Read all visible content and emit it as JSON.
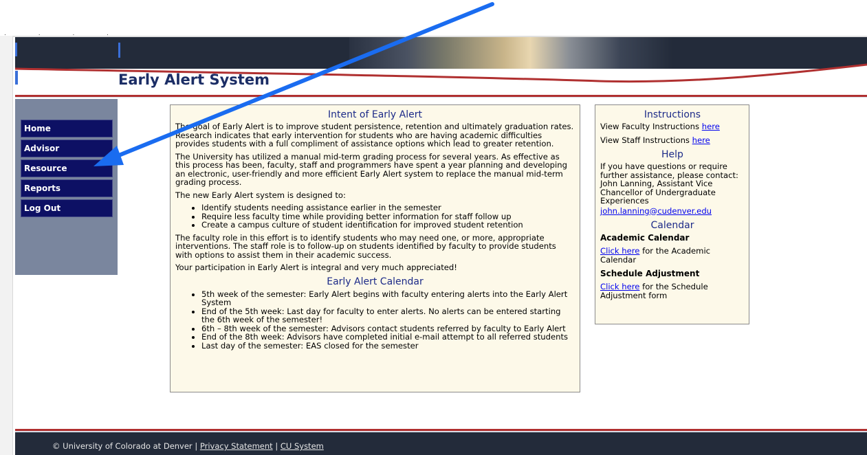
{
  "header": {
    "title": "Early Alert System"
  },
  "nav": {
    "items": [
      {
        "label": "Home"
      },
      {
        "label": "Advisor"
      },
      {
        "label": "Resource"
      },
      {
        "label": "Reports"
      },
      {
        "label": "Log Out"
      }
    ]
  },
  "main": {
    "heading": "Intent of Early Alert",
    "p1": "The goal of Early Alert is to improve student persistence, retention and ultimately graduation rates. Research indicates that early intervention for students who are having academic difficulties provides students with a full compliment of assistance options which lead to greater retention.",
    "p2": "The University has utilized a manual mid-term grading process for several years. As effective as this process has been, faculty, staff and programmers have spent a year planning and developing an electronic, user-friendly and more efficient Early Alert system to replace the manual mid-term grading process.",
    "p3": "The new Early Alert system is designed to:",
    "goals": [
      "Identify students needing assistance earlier in the semester",
      "Require less faculty time while providing better information for staff follow up",
      "Create a campus culture of student identification for improved student retention"
    ],
    "p4": "The faculty role in this effort is to identify students who may need one, or more, appropriate interventions. The staff role is to follow-up on students identified by faculty to provide students with options to assist them in their academic success.",
    "p5": "Your participation in Early Alert is integral and very much appreciated!",
    "calendar_heading": "Early Alert Calendar",
    "calendar": [
      "5th week of the semester: Early Alert begins with faculty entering alerts into the Early Alert System",
      "End of the 5th week: Last day for faculty to enter alerts. No alerts can be entered starting the 6th week of the semester!",
      "6th – 8th week of the semester: Advisors contact students referred by faculty to Early Alert",
      "End of the 8th week: Advisors have completed initial e-mail attempt to all referred students",
      "Last day of the semester: EAS closed for the semester"
    ]
  },
  "side": {
    "instructions_heading": "Instructions",
    "faculty_text": "View Faculty Instructions",
    "staff_text": "View Staff Instructions",
    "here_link": "here",
    "help_heading": "Help",
    "help_text": "If you have questions or require further assistance, please contact: John Lanning, Assistant Vice Chancellor of Undergraduate Experiences",
    "help_email": "john.lanning@cudenver.edu",
    "calendar_heading": "Calendar",
    "academic_label": "Academic Calendar",
    "academic_link": "Click here",
    "academic_text": "for the Academic Calendar",
    "schedule_label": "Schedule Adjustment",
    "schedule_link": "Click here",
    "schedule_text": "for the Schedule Adjustment form"
  },
  "footer": {
    "copyright": "© University of Colorado at Denver |",
    "privacy": "Privacy Statement",
    "separator": "|",
    "cu_system": "CU System"
  },
  "colors": {
    "header_dark": "#232b3a",
    "nav_blue": "#0d1064",
    "sidebar_gray": "#7a869e",
    "panel_bg": "#fdf9e9",
    "accent_red": "#b03030",
    "arrow_blue": "#1a6cf0"
  }
}
